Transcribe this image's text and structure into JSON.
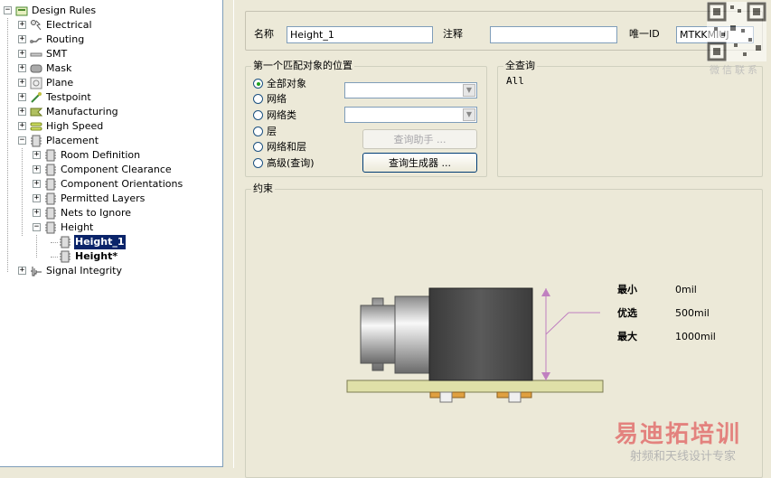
{
  "tree": {
    "items": [
      {
        "label": "Design Rules",
        "icon": "design-rules-icon",
        "expanded": true,
        "level": 0
      },
      {
        "label": "Electrical",
        "icon": "electrical-icon",
        "expanded": false,
        "level": 1
      },
      {
        "label": "Routing",
        "icon": "routing-icon",
        "expanded": false,
        "level": 1
      },
      {
        "label": "SMT",
        "icon": "smt-icon",
        "expanded": false,
        "level": 1
      },
      {
        "label": "Mask",
        "icon": "mask-icon",
        "expanded": false,
        "level": 1
      },
      {
        "label": "Plane",
        "icon": "plane-icon",
        "expanded": false,
        "level": 1
      },
      {
        "label": "Testpoint",
        "icon": "testpoint-icon",
        "expanded": false,
        "level": 1
      },
      {
        "label": "Manufacturing",
        "icon": "manufacturing-icon",
        "expanded": false,
        "level": 1
      },
      {
        "label": "High Speed",
        "icon": "high-speed-icon",
        "expanded": false,
        "level": 1
      },
      {
        "label": "Placement",
        "icon": "placement-icon",
        "expanded": true,
        "level": 1
      },
      {
        "label": "Room Definition",
        "icon": "component-icon",
        "expanded": false,
        "level": 2
      },
      {
        "label": "Component Clearance",
        "icon": "component-icon",
        "expanded": false,
        "level": 2
      },
      {
        "label": "Component Orientations",
        "icon": "component-icon",
        "expanded": false,
        "level": 2
      },
      {
        "label": "Permitted Layers",
        "icon": "component-icon",
        "expanded": false,
        "level": 2
      },
      {
        "label": "Nets to Ignore",
        "icon": "component-icon",
        "expanded": false,
        "level": 2
      },
      {
        "label": "Height",
        "icon": "component-icon",
        "expanded": true,
        "level": 2
      },
      {
        "label": "Height_1",
        "icon": "component-icon",
        "level": 3,
        "selected": true
      },
      {
        "label": "Height*",
        "icon": "component-icon",
        "level": 3,
        "bold": true
      },
      {
        "label": "Signal Integrity",
        "icon": "signal-integrity-icon",
        "expanded": false,
        "level": 1
      }
    ]
  },
  "rule": {
    "name_label": "名称",
    "name_value": "Height_1",
    "comment_label": "注释",
    "comment_value": "",
    "uid_label": "唯一ID",
    "uid_value": "MTKKMIUJ"
  },
  "match": {
    "title": "第一个匹配对象的位置",
    "options": [
      "全部对象",
      "网络",
      "网络类",
      "层",
      "网络和层",
      "高级(查询)"
    ],
    "selected_index": 0,
    "query_helper_label": "查询助手 ...",
    "query_builder_label": "查询生成器 ..."
  },
  "query": {
    "title": "全查询",
    "text": "All"
  },
  "constraints": {
    "title": "约束",
    "rows": [
      {
        "label": "最小",
        "value": "0mil"
      },
      {
        "label": "优选",
        "value": "500mil"
      },
      {
        "label": "最大",
        "value": "1000mil"
      }
    ]
  },
  "watermark": {
    "brand": "易迪拓培训",
    "sub": "射频和天线设计专家",
    "qr_caption": "微信联系"
  },
  "colors": {
    "selection": "#0a246a",
    "dialog_bg": "#ece9d8",
    "pcb": "#dfe0a8",
    "component": "#555555"
  }
}
